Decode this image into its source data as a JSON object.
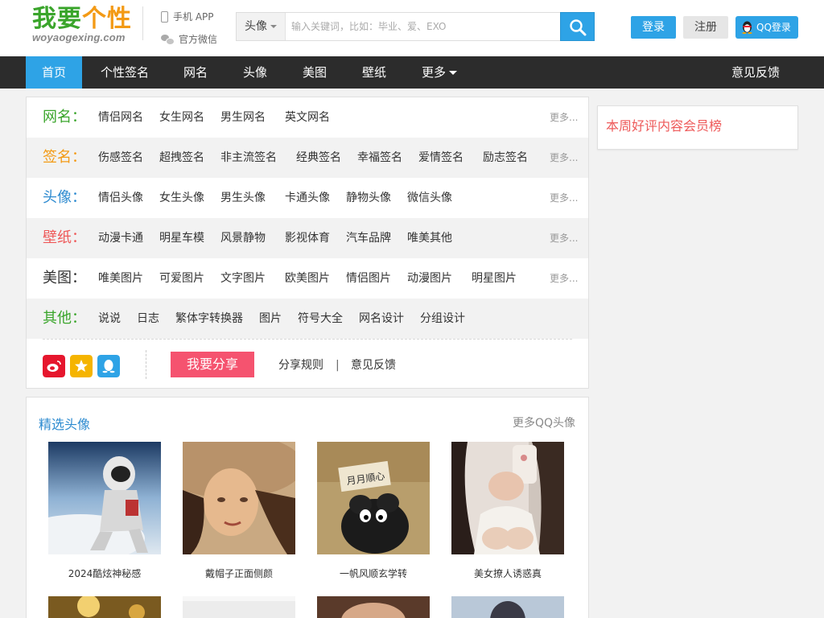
{
  "colors": {
    "accent": "#2ea3e6",
    "nav_bg": "#2c2c2c",
    "share": "#f5536f",
    "logo_green": "#3aa52b",
    "logo_orange": "#f39a15"
  },
  "logo": {
    "part1": "我要",
    "part2": "个性",
    "sub": "woyaogexing.com"
  },
  "header": {
    "app": "手机 APP",
    "wechat": "官方微信",
    "login": "登录",
    "register": "注册",
    "qq_login": "QQ登录"
  },
  "search": {
    "category": "头像",
    "placeholder": "输入关键词，比如：毕业、爱、EXO",
    "value": ""
  },
  "nav": {
    "items": [
      "首页",
      "个性签名",
      "网名",
      "头像",
      "美图",
      "壁纸",
      "更多"
    ],
    "feedback": "意见反馈"
  },
  "categories": [
    {
      "title": "网名：",
      "color": "#3aa52b",
      "links": [
        "情侣网名",
        "女生网名",
        "男生网名",
        "英文网名"
      ],
      "more": "更多..."
    },
    {
      "title": "签名：",
      "color": "#f39a15",
      "links": [
        "伤感签名",
        "超拽签名",
        "非主流签名",
        "经典签名",
        "幸福签名",
        "爱情签名",
        "励志签名"
      ],
      "more": "更多..."
    },
    {
      "title": "头像：",
      "color": "#2e8bd0",
      "links": [
        "情侣头像",
        "女生头像",
        "男生头像",
        "卡通头像",
        "静物头像",
        "微信头像"
      ],
      "more": "更多..."
    },
    {
      "title": "壁纸：",
      "color": "#ee5a5a",
      "links": [
        "动漫卡通",
        "明星车模",
        "风景静物",
        "影视体育",
        "汽车品牌",
        "唯美其他"
      ],
      "more": "更多..."
    },
    {
      "title": "美图：",
      "color": "#333333",
      "links": [
        "唯美图片",
        "可爱图片",
        "文字图片",
        "欧美图片",
        "情侣图片",
        "动漫图片",
        "明星图片"
      ],
      "more": "更多..."
    },
    {
      "title": "其他：",
      "color": "#3aa52b",
      "links": [
        "说说",
        "日志",
        "繁体字转换器",
        "图片",
        "符号大全",
        "网名设计",
        "分组设计"
      ],
      "more": ""
    }
  ],
  "share": {
    "button": "我要分享",
    "rules": "分享规则",
    "sep": "|",
    "feedback": "意见反馈",
    "icons": [
      "weibo-icon",
      "qzone-icon",
      "qq-icon"
    ]
  },
  "rank": {
    "title": "本周好评内容会员榜"
  },
  "featured": {
    "title": "精选头像",
    "more": "更多QQ头像",
    "items": [
      {
        "caption": "2024酷炫神秘感"
      },
      {
        "caption": "戴帽子正面侧颜"
      },
      {
        "caption": "一帆风顺玄学转"
      },
      {
        "caption": "美女撩人诱惑真"
      }
    ]
  }
}
